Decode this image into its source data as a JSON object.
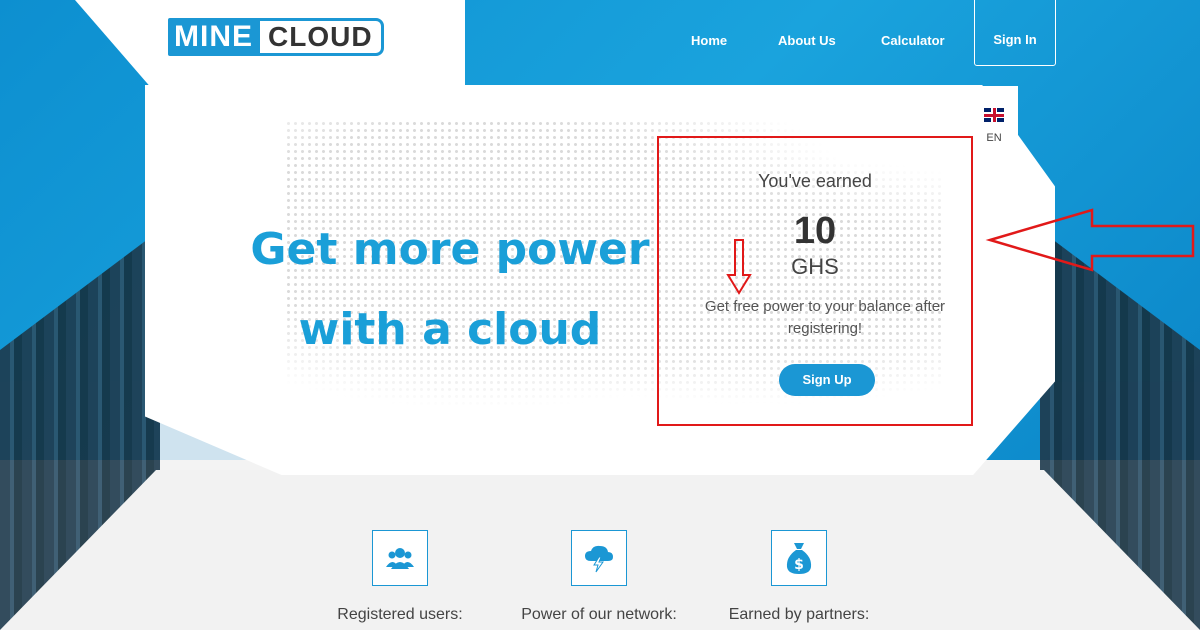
{
  "colors": {
    "brand_blue": "#1b97d4",
    "annotation_red": "#e11919",
    "headline_blue": "#1a9fd8"
  },
  "logo": {
    "part1": "MINE",
    "part2": "CLOUD"
  },
  "nav": {
    "items": [
      {
        "label": "Home"
      },
      {
        "label": "About Us"
      },
      {
        "label": "Calculator"
      }
    ],
    "sign_in": "Sign In"
  },
  "language": {
    "code": "EN",
    "icon": "uk-flag-icon"
  },
  "hero": {
    "line1": "Get more power",
    "line2": "with a cloud"
  },
  "earn": {
    "title": "You've earned",
    "value": "10",
    "unit": "GHS",
    "description": "Get free power to your balance after registering!",
    "button": "Sign Up"
  },
  "stats": [
    {
      "label": "Registered users:",
      "icon": "users-icon"
    },
    {
      "label": "Power of our network:",
      "icon": "cloud-lightning-icon"
    },
    {
      "label": "Earned by partners:",
      "icon": "money-bag-icon"
    }
  ]
}
